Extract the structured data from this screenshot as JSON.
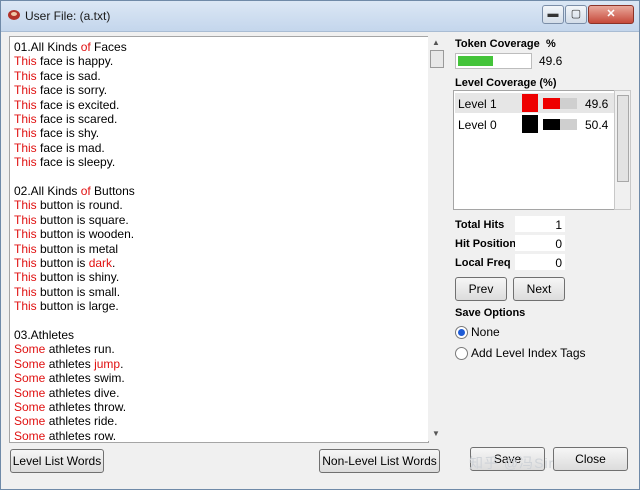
{
  "window": {
    "title": "User File: (a.txt)",
    "min_label": "▬",
    "max_label": "▢",
    "close_label": "✕"
  },
  "text_lines": [
    {
      "parts": [
        {
          "t": "01.All Kinds ",
          "c": "b"
        },
        {
          "t": "of",
          "c": "r"
        },
        {
          "t": " Faces",
          "c": "b"
        }
      ]
    },
    {
      "parts": [
        {
          "t": "This",
          "c": "r"
        },
        {
          "t": " face is happy.",
          "c": "b"
        }
      ]
    },
    {
      "parts": [
        {
          "t": "This",
          "c": "r"
        },
        {
          "t": " face is sad.",
          "c": "b"
        }
      ]
    },
    {
      "parts": [
        {
          "t": "This",
          "c": "r"
        },
        {
          "t": " face is sorry.",
          "c": "b"
        }
      ]
    },
    {
      "parts": [
        {
          "t": "This",
          "c": "r"
        },
        {
          "t": " face is excited.",
          "c": "b"
        }
      ]
    },
    {
      "parts": [
        {
          "t": "This",
          "c": "r"
        },
        {
          "t": " face is scared.",
          "c": "b"
        }
      ]
    },
    {
      "parts": [
        {
          "t": "This",
          "c": "r"
        },
        {
          "t": " face is shy.",
          "c": "b"
        }
      ]
    },
    {
      "parts": [
        {
          "t": "This",
          "c": "r"
        },
        {
          "t": " face is mad.",
          "c": "b"
        }
      ]
    },
    {
      "parts": [
        {
          "t": "This",
          "c": "r"
        },
        {
          "t": " face is sleepy.",
          "c": "b"
        }
      ]
    },
    {
      "parts": []
    },
    {
      "parts": [
        {
          "t": "02.All Kinds ",
          "c": "b"
        },
        {
          "t": "of",
          "c": "r"
        },
        {
          "t": " Buttons",
          "c": "b"
        }
      ]
    },
    {
      "parts": [
        {
          "t": "This",
          "c": "r"
        },
        {
          "t": " button is round.",
          "c": "b"
        }
      ]
    },
    {
      "parts": [
        {
          "t": "This",
          "c": "r"
        },
        {
          "t": " button is square.",
          "c": "b"
        }
      ]
    },
    {
      "parts": [
        {
          "t": "This",
          "c": "r"
        },
        {
          "t": " button is wooden.",
          "c": "b"
        }
      ]
    },
    {
      "parts": [
        {
          "t": "This",
          "c": "r"
        },
        {
          "t": " button is metal",
          "c": "b"
        }
      ]
    },
    {
      "parts": [
        {
          "t": "This",
          "c": "r"
        },
        {
          "t": " button is ",
          "c": "b"
        },
        {
          "t": "dark",
          "c": "r"
        },
        {
          "t": ".",
          "c": "b"
        }
      ]
    },
    {
      "parts": [
        {
          "t": "This",
          "c": "r"
        },
        {
          "t": " button is shiny.",
          "c": "b"
        }
      ]
    },
    {
      "parts": [
        {
          "t": "This",
          "c": "r"
        },
        {
          "t": " button is small.",
          "c": "b"
        }
      ]
    },
    {
      "parts": [
        {
          "t": "This",
          "c": "r"
        },
        {
          "t": " button is large.",
          "c": "b"
        }
      ]
    },
    {
      "parts": []
    },
    {
      "parts": [
        {
          "t": "03.Athletes",
          "c": "b"
        }
      ]
    },
    {
      "parts": [
        {
          "t": "Some",
          "c": "r"
        },
        {
          "t": " athletes run.",
          "c": "b"
        }
      ]
    },
    {
      "parts": [
        {
          "t": "Some",
          "c": "r"
        },
        {
          "t": " athletes ",
          "c": "b"
        },
        {
          "t": "jump",
          "c": "r"
        },
        {
          "t": ".",
          "c": "b"
        }
      ]
    },
    {
      "parts": [
        {
          "t": "Some",
          "c": "r"
        },
        {
          "t": " athletes swim.",
          "c": "b"
        }
      ]
    },
    {
      "parts": [
        {
          "t": "Some",
          "c": "r"
        },
        {
          "t": " athletes dive.",
          "c": "b"
        }
      ]
    },
    {
      "parts": [
        {
          "t": "Some",
          "c": "r"
        },
        {
          "t": " athletes throw.",
          "c": "b"
        }
      ]
    },
    {
      "parts": [
        {
          "t": "Some",
          "c": "r"
        },
        {
          "t": " athletes ride.",
          "c": "b"
        }
      ]
    },
    {
      "parts": [
        {
          "t": "Some",
          "c": "r"
        },
        {
          "t": " athletes row.",
          "c": "b"
        }
      ]
    }
  ],
  "buttons": {
    "level_list": "Level List Words",
    "nonlevel_list": "Non-Level List Words",
    "prev": "Prev",
    "next": "Next",
    "save": "Save",
    "close": "Close"
  },
  "token_coverage": {
    "label": "Token Coverage",
    "pct_label": "%",
    "value": "49.6",
    "fill_fraction": 0.496,
    "color": "#44c43a"
  },
  "level_coverage": {
    "label": "Level Coverage (%)",
    "levels": [
      {
        "name": "Level 1",
        "color": "#ee0000",
        "value": "49.6",
        "fill_fraction": 0.496
      },
      {
        "name": "Level 0",
        "color": "#000000",
        "value": "50.4",
        "fill_fraction": 0.504
      }
    ]
  },
  "stats": {
    "total_hits_label": "Total Hits",
    "total_hits": "1",
    "hit_position_label": "Hit Position",
    "hit_position": "0",
    "local_freq_label": "Local Freq",
    "local_freq": "0"
  },
  "save_options": {
    "label": "Save Options",
    "none_label": "None",
    "tags_label": "Add Level Index Tags",
    "selected": "none"
  },
  "watermark": "知乎 @冯Sir"
}
